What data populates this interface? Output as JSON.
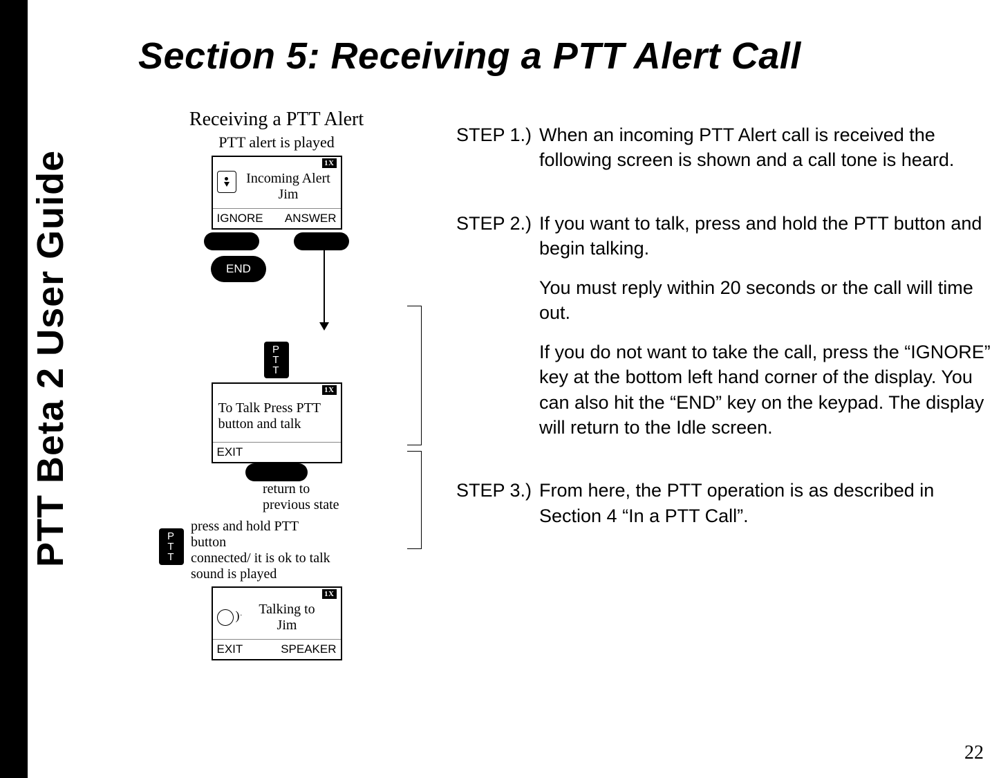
{
  "vertical_title": "PTT Beta 2 User Guide",
  "page_title": "Section 5: Receiving a PTT Alert Call",
  "figure": {
    "title": "Receiving a PTT Alert",
    "subtitle": "PTT alert is played",
    "screen1": {
      "status": "1X",
      "line1": "Incoming Alert",
      "line2": "Jim",
      "softleft": "IGNORE",
      "softright": "ANSWER"
    },
    "end_label": "END",
    "ptt_label": "P\nT\nT",
    "screen2": {
      "status": "1X",
      "line1": "To Talk Press PTT",
      "line2": "button and talk",
      "softleft": "EXIT"
    },
    "return_text1": "return to",
    "return_text2": "previous state",
    "ptt_instr1": "press  and hold PTT",
    "ptt_instr2": "button",
    "ptt_instr3": "connected/ it is ok to talk",
    "ptt_instr4": "sound is played",
    "screen3": {
      "status": "1X",
      "line1": "Talking to",
      "line2": "Jim",
      "softleft": "EXIT",
      "softright": "SPEAKER"
    }
  },
  "steps": {
    "s1": {
      "label": "STEP 1.)",
      "body": "When an incoming PTT Alert call is received the following screen is shown and a call tone is heard."
    },
    "s2": {
      "label": "STEP 2.)",
      "body1": "If you want to talk, press and hold the PTT button and begin talking.",
      "body2": "You must reply within 20 seconds or  the call will time out.",
      "body3": "If you do not want to take the call, press the “IGNORE” key at the bottom left hand corner of the display.  You can also hit the “END” key on the keypad.  The display will return to the Idle screen."
    },
    "s3": {
      "label": "STEP 3.)",
      "body": "From here, the PTT operation is as described in Section 4  “In a PTT Call”."
    }
  },
  "page_number": "22"
}
